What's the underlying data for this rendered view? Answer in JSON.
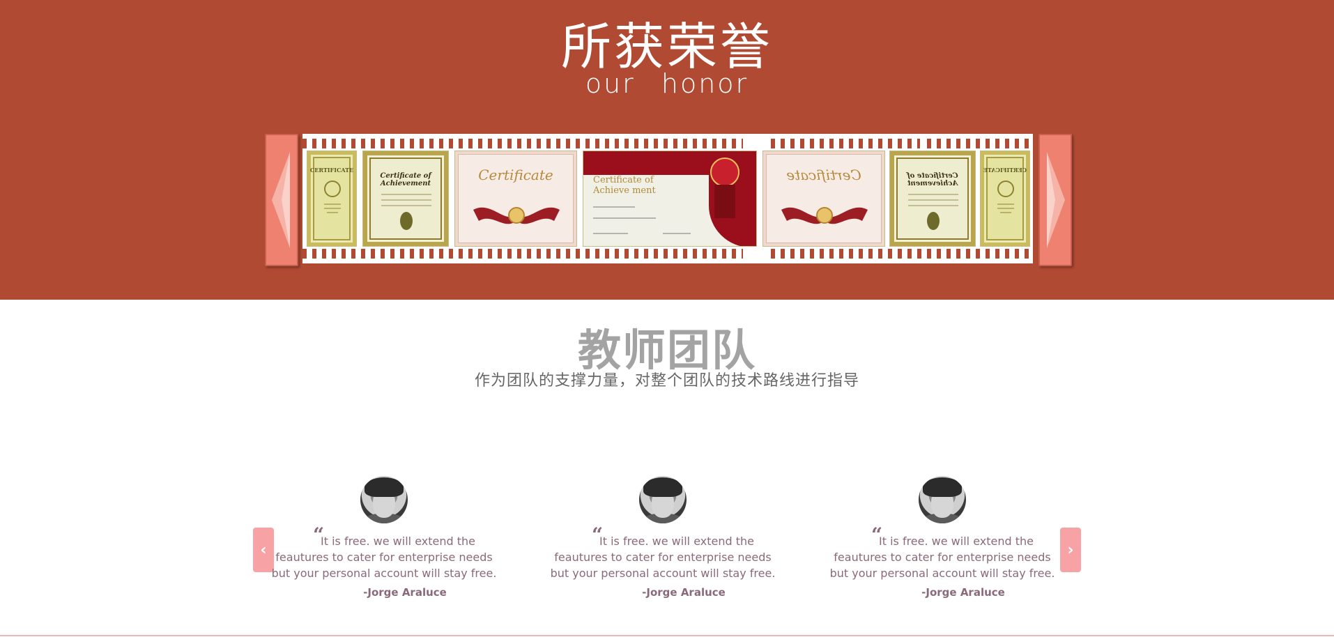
{
  "honor": {
    "title": "所获荣誉",
    "subtitle": "our honor",
    "prev_icon": "triangle-left-icon",
    "next_icon": "triangle-right-icon",
    "certificates": [
      {
        "kind": "gold",
        "label": "CERTIFICATE"
      },
      {
        "kind": "gold-ornate",
        "label": "Certificate of Achievement"
      },
      {
        "kind": "cream",
        "label": "Certificate"
      },
      {
        "kind": "red",
        "label": "Certificate of Achieve ment"
      },
      {
        "kind": "cream",
        "label": "Certificate"
      },
      {
        "kind": "gold-ornate",
        "label": "Certificate of Achievement"
      },
      {
        "kind": "gold",
        "label": "CERTIFICATE"
      }
    ],
    "accent": "#b04a33",
    "button_color": "#ee8170"
  },
  "team": {
    "title": "教师团队",
    "subtitle": "作为团队的支撑力量，对整个团队的技术路线进行指导",
    "prev_icon": "chevron-left-icon",
    "next_icon": "chevron-right-icon",
    "testimonials": [
      {
        "quote_mark": "“",
        "lines": [
          "It is free. we will extend the",
          "feautures to cater for enterprise needs",
          "but your personal account will stay free."
        ],
        "author": "-Jorge Araluce"
      },
      {
        "quote_mark": "“",
        "lines": [
          "It is free. we will extend the",
          "feautures to cater for enterprise needs",
          "but your personal account will stay free."
        ],
        "author": "-Jorge Araluce"
      },
      {
        "quote_mark": "“",
        "lines": [
          "It is free. we will extend the",
          "feautures to cater for enterprise needs",
          "but your personal account will stay free."
        ],
        "author": "-Jorge Araluce"
      }
    ],
    "button_color": "#f7a3a5"
  }
}
